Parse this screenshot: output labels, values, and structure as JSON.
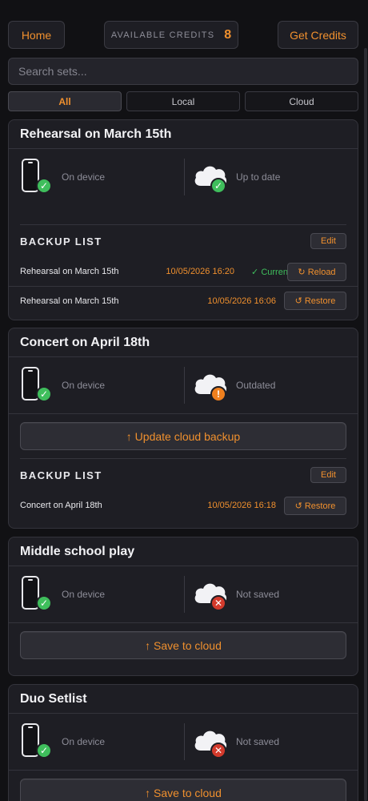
{
  "topbar": {
    "home_label": "Home",
    "credits_label": "AVAILABLE CREDITS",
    "credits_value": "8",
    "get_credits_label": "Get Credits"
  },
  "search": {
    "placeholder": "Search sets..."
  },
  "filters": [
    "All",
    "Local",
    "Cloud"
  ],
  "filter_active": "All",
  "cards": [
    {
      "title": "Rehearsal on March 15th",
      "device_status": "On device",
      "cloud_status": "Up to date",
      "backup_title": "BACKUP LIST",
      "edit_label": "Edit",
      "backups": [
        {
          "name": "Rehearsal on March 15th",
          "date": "10/05/2026 16:20",
          "current": "✓ Current",
          "action": "↻ Reload"
        },
        {
          "name": "Rehearsal on March 15th",
          "date": "10/05/2026 16:06",
          "action": "↺ Restore"
        }
      ]
    },
    {
      "title": "Concert on April 18th",
      "device_status": "On device",
      "cloud_status": "Outdated",
      "action_label": "↑ Update cloud backup",
      "backup_title": "BACKUP LIST",
      "edit_label": "Edit",
      "backups": [
        {
          "name": "Concert on April 18th",
          "date": "10/05/2026 16:18",
          "action": "↺ Restore"
        }
      ]
    },
    {
      "title": "Middle school play",
      "device_status": "On device",
      "cloud_status": "Not saved",
      "action_label": "↑ Save to cloud"
    },
    {
      "title": "Duo Setlist",
      "device_status": "On device",
      "cloud_status": "Not saved",
      "action_label": "↑ Save to cloud"
    }
  ],
  "colors": {
    "accent": "#f0902e",
    "ok": "#3fbe5c",
    "warn": "#f0801e",
    "error": "#d33a2c",
    "background": "#111114",
    "card": "#1e1e24"
  }
}
